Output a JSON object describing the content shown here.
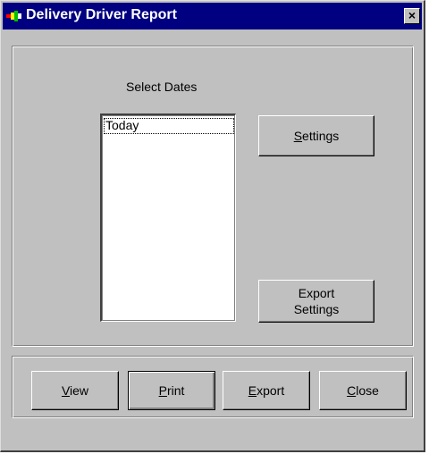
{
  "window": {
    "title": "Delivery Driver Report",
    "close_glyph": "×"
  },
  "dates": {
    "label": "Select Dates",
    "items": [
      "Today"
    ]
  },
  "buttons": {
    "settings": {
      "mnemonic": "S",
      "rest": "ettings"
    },
    "export_settings": {
      "line1": "Export",
      "line2": "Settings"
    },
    "view": {
      "mnemonic": "V",
      "rest": "iew"
    },
    "print": {
      "mnemonic": "P",
      "rest": "rint"
    },
    "export": {
      "mnemonic": "E",
      "rest": "xport"
    },
    "close": {
      "mnemonic": "C",
      "rest": "lose"
    }
  },
  "colors": {
    "titlebar": "#000080",
    "face": "#c0c0c0"
  },
  "icons": {
    "app": "app-icon",
    "close": "close-icon"
  }
}
